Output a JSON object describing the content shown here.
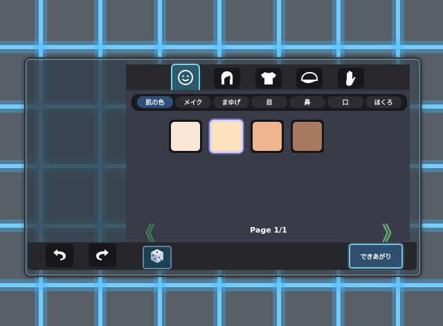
{
  "category_tabs": [
    {
      "icon": "face-smile-icon"
    },
    {
      "icon": "hair-icon"
    },
    {
      "icon": "shirt-icon"
    },
    {
      "icon": "cap-icon"
    },
    {
      "icon": "hand-icon"
    }
  ],
  "active_category": 0,
  "sub_tabs": [
    "肌の色",
    "メイク",
    "まゆげ",
    "目",
    "鼻",
    "口",
    "ほくろ"
  ],
  "active_sub_tab": 0,
  "skin_colors": [
    "#fbe6d8",
    "#fde2be",
    "#eeb68d",
    "#a67a60"
  ],
  "selected_skin_color": 1,
  "pagination": {
    "label": "Page 1/1",
    "prev_glyph": "《",
    "next_glyph": "》"
  },
  "bottom_bar": {
    "undo_icon": "undo-icon",
    "redo_icon": "redo-icon",
    "random_icon": "dice-icon",
    "done_label": "できあがり"
  },
  "colors": {
    "accent": "#7fd2ec",
    "active_subtab": "#2d4f78",
    "panel": "#3a3b48"
  }
}
